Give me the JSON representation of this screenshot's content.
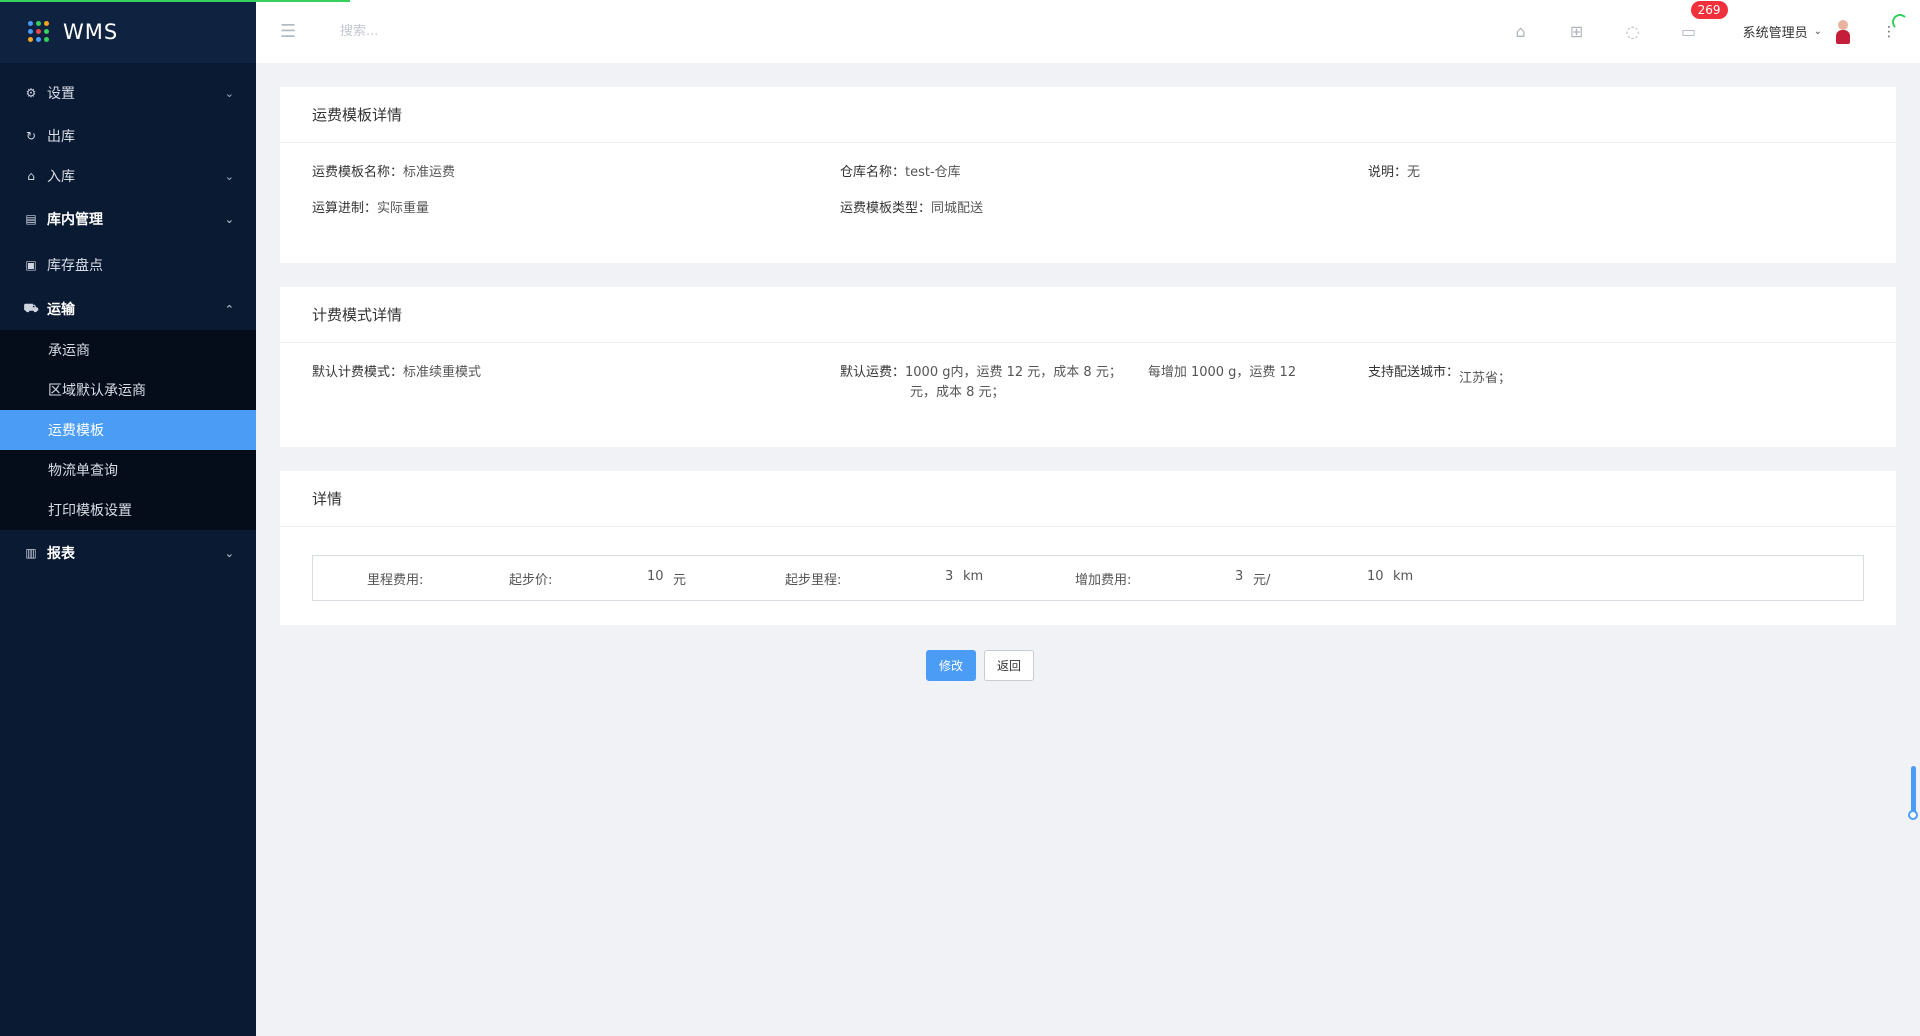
{
  "app": {
    "name": "WMS"
  },
  "colors": {
    "sidebar_bg": "#0b1a33",
    "accent": "#4a9cf5",
    "badge": "#f0303b",
    "logo_dots": [
      "#4a9cf5",
      "#35d05d",
      "#f5a623",
      "#4a9cf5",
      "#e84b4b",
      "#35d05d",
      "#f5a623",
      "#4a9cf5",
      "#35d05d"
    ]
  },
  "sidebar": {
    "items": [
      {
        "label": "设置",
        "icon": "gear-icon",
        "chevron": "⌄"
      },
      {
        "label": "出库",
        "icon": "refresh-icon",
        "chevron": ""
      },
      {
        "label": "入库",
        "icon": "home-icon",
        "chevron": "⌄"
      },
      {
        "label": "库内管理",
        "icon": "archive-icon",
        "chevron": "⌄"
      },
      {
        "label": "库存盘点",
        "icon": "clipboard-icon",
        "chevron": ""
      },
      {
        "label": "运输",
        "icon": "truck-icon",
        "chevron": "⌃"
      }
    ],
    "submenu": [
      "承运商",
      "区域默认承运商",
      "运费模板",
      "物流单查询",
      "打印模板设置"
    ],
    "report": {
      "label": "报表",
      "icon": "bar-chart-icon",
      "chevron": "⌄"
    }
  },
  "header": {
    "search_placeholder": "搜索...",
    "badge_count": "269",
    "user": "系统管理员"
  },
  "section1": {
    "title": "运费模板详情",
    "fields": [
      {
        "k": "运费模板名称：",
        "v": "标准运费"
      },
      {
        "k": "仓库名称：",
        "v": "test-仓库"
      },
      {
        "k": "说明：",
        "v": "无"
      },
      {
        "k": "运算进制：",
        "v": "实际重量"
      },
      {
        "k": "运费模板类型：",
        "v": "同城配送"
      }
    ]
  },
  "section2": {
    "title": "计费模式详情",
    "mode": {
      "k": "默认计费模式：",
      "v": "标准续重模式"
    },
    "fee": {
      "k": "默认运费：",
      "line1": "1000 g内，运费 12 元，成本 8 元；",
      "line1b": "每增加 1000 g，运费 12",
      "line2": "元，成本 8 元；"
    },
    "cities": {
      "k": "支持配送城市：",
      "v": "江苏省；"
    }
  },
  "section3": {
    "title": "详情",
    "row": {
      "mileage_label": "里程费用:",
      "start_price_label": "起步价:",
      "start_price": "10",
      "start_price_unit": "元",
      "start_km_label": "起步里程:",
      "start_km": "3",
      "start_km_unit": "km",
      "add_fee_label": "增加费用:",
      "add_fee": "3",
      "add_fee_unit": "元/",
      "add_km": "10",
      "add_km_unit": "km"
    }
  },
  "buttons": {
    "edit": "修改",
    "back": "返回"
  }
}
